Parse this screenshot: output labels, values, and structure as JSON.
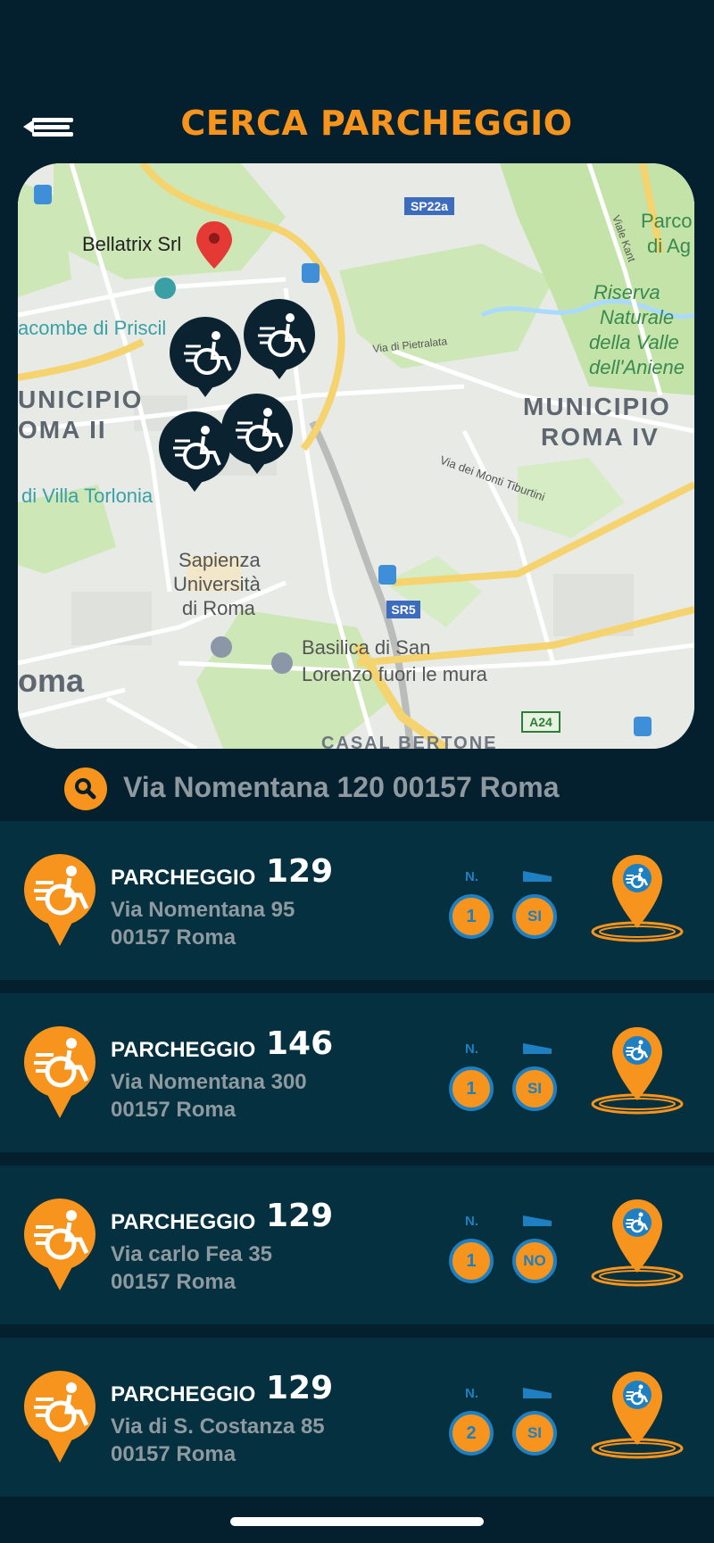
{
  "header": {
    "title": "CERCA PARCHEGGIO",
    "menu_icon": "menu-back-icon"
  },
  "map": {
    "labels": {
      "bellatrix": "Bellatrix Srl",
      "sp22a": "SP22a",
      "parco_1": "Parco",
      "parco_2": "di Ag",
      "viale_kant": "Viale Kant",
      "riserva_1": "Riserva",
      "riserva_2": "Naturale",
      "riserva_3": "della Valle",
      "riserva_4": "dell'Aniene",
      "catacombe": "acombe di Priscil",
      "municipio2_1": "UNICIPIO",
      "municipio2_2": "OMA II",
      "municipio4_1": "MUNICIPIO",
      "municipio4_2": "ROMA IV",
      "via_pietralata": "Via di Pietralata",
      "via_monti": "Via dei Monti Tiburtini",
      "villa_torlonia": "di Villa Torlonia",
      "sapienza_1": "Sapienza",
      "sapienza_2": "Università",
      "sapienza_3": "di Roma",
      "sr5": "SR5",
      "basilica_1": "Basilica di San",
      "basilica_2": "Lorenzo fuori le mura",
      "roma": "oma",
      "a24": "A24",
      "casal": "CASAL BERTONE"
    },
    "colors": {
      "road_major": "#f5d36e",
      "park": "#c7e6b0",
      "water": "#aadaff",
      "marker": "#0b2230",
      "red_pin": "#e53935"
    }
  },
  "search": {
    "icon": "search-icon",
    "value": "Via Nomentana 120 00157 Roma"
  },
  "parkings": [
    {
      "name": "PARCHEGGIO",
      "number": "129",
      "street": "Via Nomentana 95",
      "city": "00157 Roma",
      "n_label": "N.",
      "count": "1",
      "ramp": "SI"
    },
    {
      "name": "PARCHEGGIO",
      "number": "146",
      "street": "Via Nomentana 300",
      "city": "00157 Roma",
      "n_label": "N.",
      "count": "1",
      "ramp": "SI"
    },
    {
      "name": "PARCHEGGIO",
      "number": "129",
      "street": "Via carlo Fea 35",
      "city": "00157 Roma",
      "n_label": "N.",
      "count": "1",
      "ramp": "NO"
    },
    {
      "name": "PARCHEGGIO",
      "number": "129",
      "street": "Via di S. Costanza 85",
      "city": "00157 Roma",
      "n_label": "N.",
      "count": "2",
      "ramp": "SI"
    }
  ],
  "colors": {
    "background": "#04202e",
    "row": "#04303f",
    "accent": "#f7941d",
    "badge_border": "#1e7fc1",
    "muted_text": "#8f9aa0"
  }
}
